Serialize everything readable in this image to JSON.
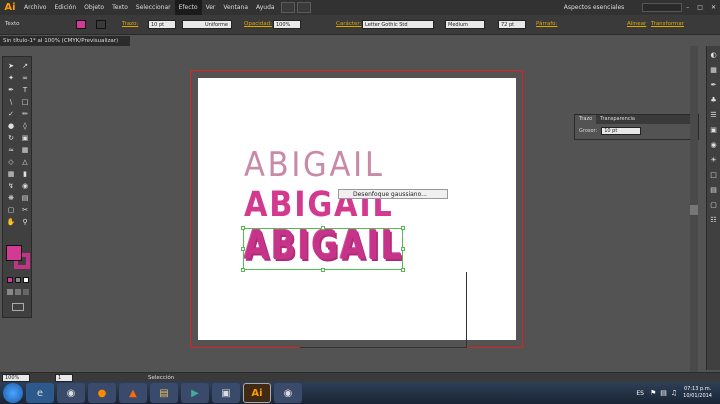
{
  "app": {
    "logo": "Ai",
    "menus": [
      "Archivo",
      "Edición",
      "Objeto",
      "Texto",
      "Seleccionar",
      "Efecto",
      "Ver",
      "Ventana",
      "Ayuda"
    ],
    "active_menu": "Efecto",
    "workspace": "Aspectos esenciales"
  },
  "control_bar": {
    "object_type": "Texto",
    "stroke_label": "Trazo:",
    "stroke_weight": "10 pt",
    "brush": "Uniforme",
    "opacity_label": "Opacidad:",
    "opacity_value": "100%",
    "character_label": "Carácter:",
    "font_family": "Letter Gothic Std",
    "font_style": "Medium",
    "font_size": "72 pt",
    "paragraph_label": "Párrafo:",
    "align_label": "Alinear",
    "transform_label": "Transformar",
    "fill_color": "#d23a96",
    "stroke_color": "#c23488"
  },
  "document": {
    "tab_title": "Sin título-1* al 100% (CMYK/Previsualizar)"
  },
  "canvas": {
    "line1": "ABIGAIL",
    "line2": "ABIGAIL",
    "line3": "ABIGAIL",
    "tooltip": "Desenfoque gaussiano..."
  },
  "stroke_panel": {
    "tab_stroke": "Trazo",
    "tab_transparency": "Transparencia",
    "weight_label": "Grosor:",
    "weight_value": "10 pt"
  },
  "status_bar": {
    "zoom": "100%",
    "page": "1",
    "tool": "Selección"
  },
  "taskbar": {
    "language": "ES",
    "time": "07:13 p.m.",
    "date": "10/01/2014",
    "ai_label": "Ai"
  },
  "toolbox": {
    "fill_swatch": "#d23a96",
    "stroke_swatch": "#c23488"
  }
}
